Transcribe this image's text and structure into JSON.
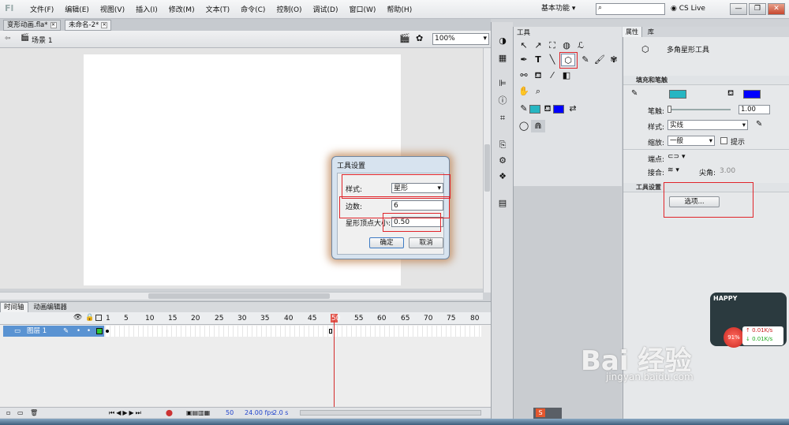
{
  "menubar": {
    "logo": "Fl",
    "items": [
      "文件(F)",
      "编辑(E)",
      "视图(V)",
      "插入(I)",
      "修改(M)",
      "文本(T)",
      "命令(C)",
      "控制(O)",
      "调试(D)",
      "窗口(W)",
      "帮助(H)"
    ],
    "workspace": "基本功能 ▾",
    "search_placeholder": "",
    "cs_live": "CS Live",
    "window_controls": [
      "—",
      "❐",
      "✕"
    ]
  },
  "doctabs": [
    {
      "label": "变形动画.fla*",
      "active": false
    },
    {
      "label": "未命名-2*",
      "active": true
    }
  ],
  "scene": {
    "label": "场景 1",
    "zoom": "100%"
  },
  "timeline": {
    "tabs": [
      "时间轴",
      "动画编辑器"
    ],
    "ruler": [
      "1",
      "5",
      "10",
      "15",
      "20",
      "25",
      "30",
      "35",
      "40",
      "45",
      "50",
      "55",
      "60",
      "65",
      "70",
      "75",
      "80"
    ],
    "layer_name": "图层 1",
    "status": {
      "frame": "50",
      "fps": "24.00 fps",
      "time": "2.0 s"
    }
  },
  "tools": {
    "title": "工具",
    "active_tool": "polystar-tool",
    "stroke_color": "#26b6c2",
    "fill_color": "#0000ff"
  },
  "properties": {
    "tabs": [
      "属性",
      "库"
    ],
    "tool_name": "多角星形工具",
    "section_fill": "填充和笔触",
    "stroke_color": "#26b6c2",
    "fill_color": "#0000ff",
    "stroke_label": "笔触:",
    "stroke_value": "1.00",
    "style_label": "样式:",
    "style_value": "实线",
    "scale_label": "缩放:",
    "scale_value": "一般",
    "hint_label": "提示",
    "cap_label": "端点:",
    "join_label": "接合:",
    "miter_label": "尖角:",
    "miter_value": "3.00",
    "section_tool": "工具设置",
    "options_button": "选项..."
  },
  "dialog": {
    "title": "工具设置",
    "style_label": "样式:",
    "style_value": "星形",
    "sides_label": "边数:",
    "sides_value": "6",
    "point_label": "星形顶点大小:",
    "point_value": "0.50",
    "ok": "确定",
    "cancel": "取消"
  },
  "net_widget": {
    "banner": "HAPPY",
    "percent": "91%",
    "up": "0.01K/s",
    "down": "0.01K/s"
  },
  "watermark": {
    "brand": "Bai  经验",
    "url": "jingyan.baidu.com"
  }
}
